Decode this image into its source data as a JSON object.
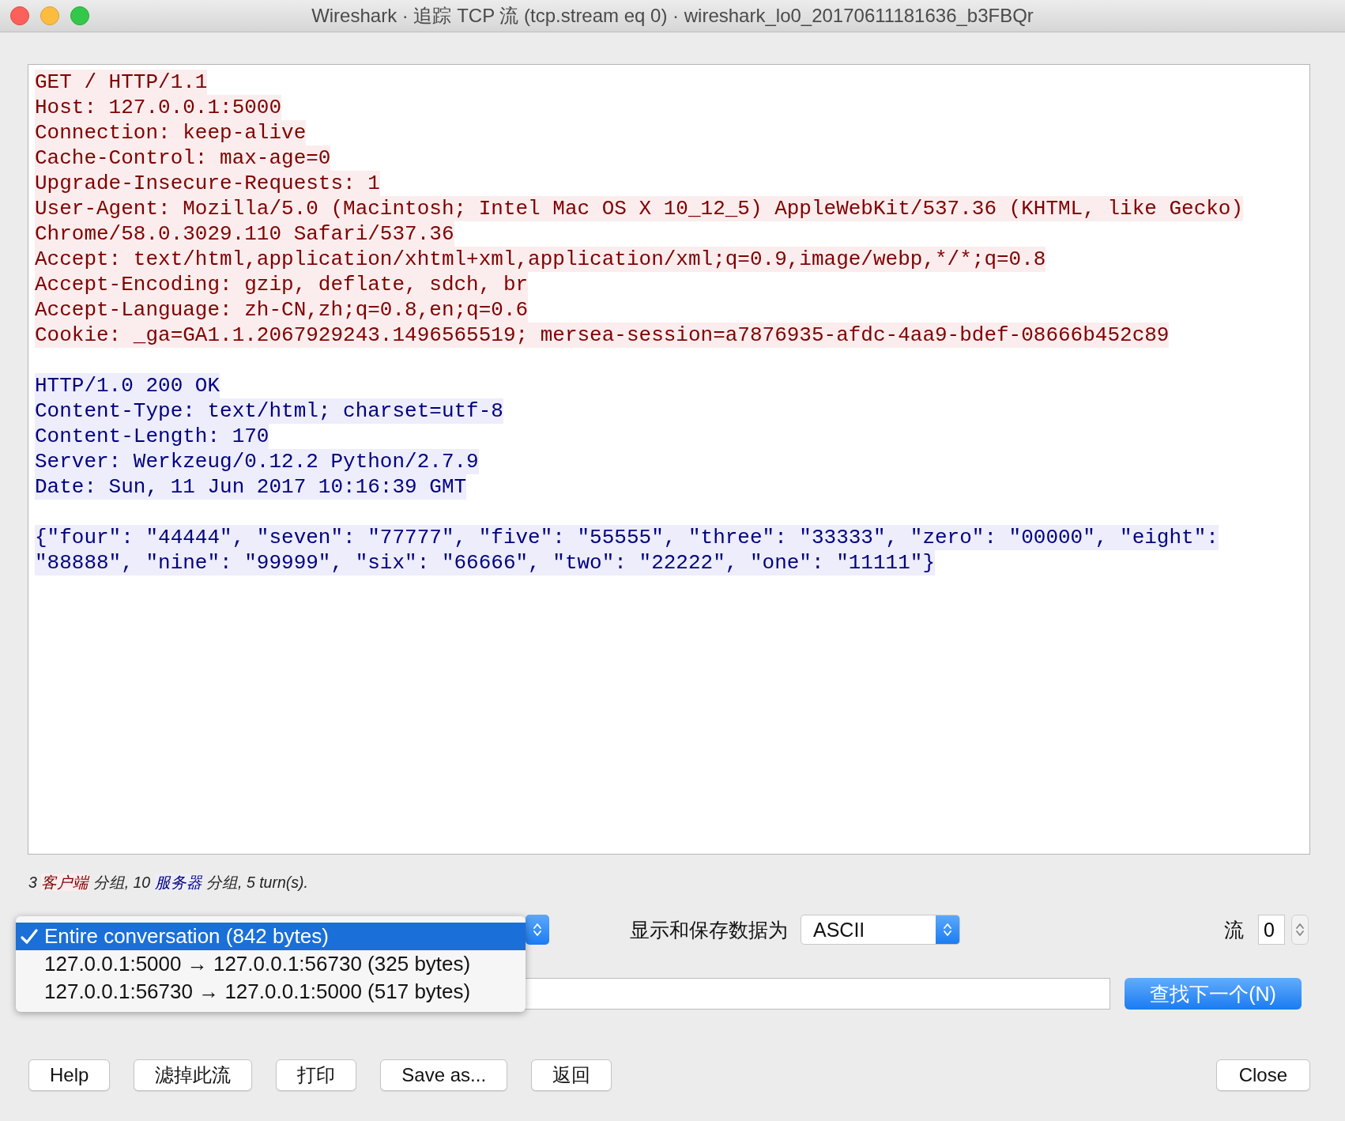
{
  "window": {
    "title": "Wireshark · 追踪 TCP 流 (tcp.stream eq 0) · wireshark_lo0_20170611181636_b3FBQr"
  },
  "stream": {
    "segments": [
      {
        "kind": "client",
        "lines": [
          "GET / HTTP/1.1",
          "Host: 127.0.0.1:5000",
          "Connection: keep-alive",
          "Cache-Control: max-age=0",
          "Upgrade-Insecure-Requests: 1",
          "User-Agent: Mozilla/5.0 (Macintosh; Intel Mac OS X 10_12_5) AppleWebKit/537.36 (KHTML, like Gecko)",
          "Chrome/58.0.3029.110 Safari/537.36",
          "Accept: text/html,application/xhtml+xml,application/xml;q=0.9,image/webp,*/*;q=0.8",
          "Accept-Encoding: gzip, deflate, sdch, br",
          "Accept-Language: zh-CN,zh;q=0.8,en;q=0.6",
          "Cookie: _ga=GA1.1.2067929243.1496565519; mersea-session=a7876935-afdc-4aa9-bdef-08666b452c89"
        ]
      },
      {
        "kind": "server",
        "lines": [
          "HTTP/1.0 200 OK",
          "Content-Type: text/html; charset=utf-8",
          "Content-Length: 170",
          "Server: Werkzeug/0.12.2 Python/2.7.9",
          "Date: Sun, 11 Jun 2017 10:16:39 GMT"
        ]
      },
      {
        "kind": "server",
        "lines": [
          "{\"four\": \"44444\", \"seven\": \"77777\", \"five\": \"55555\", \"three\": \"33333\", \"zero\": \"00000\", \"eight\":",
          "\"88888\", \"nine\": \"99999\", \"six\": \"66666\", \"two\": \"22222\", \"one\": \"11111\"}"
        ]
      }
    ]
  },
  "status_bar": {
    "parts": [
      {
        "kind": "plain",
        "text": "3 "
      },
      {
        "kind": "client",
        "text": "客户端"
      },
      {
        "kind": "plain",
        "text": " 分组, 10 "
      },
      {
        "kind": "server",
        "text": "服务器"
      },
      {
        "kind": "plain",
        "text": " 分组, 5 turn(s)."
      }
    ]
  },
  "conversation": {
    "options": [
      {
        "label": "Entire conversation (842 bytes)",
        "selected": true
      },
      {
        "label": "127.0.0.1:5000 → 127.0.0.1:56730 (325 bytes)",
        "selected": false
      },
      {
        "label": "127.0.0.1:56730 → 127.0.0.1:5000 (517 bytes)",
        "selected": false
      }
    ]
  },
  "show_as": {
    "label": "显示和保存数据为",
    "value": "ASCII"
  },
  "stream_index": {
    "label": "流",
    "value": "0"
  },
  "find": {
    "button": "查找下一个(N)"
  },
  "buttons": [
    "Help",
    "滤掉此流",
    "打印",
    "Save as...",
    "返回"
  ],
  "close_button": "Close"
}
